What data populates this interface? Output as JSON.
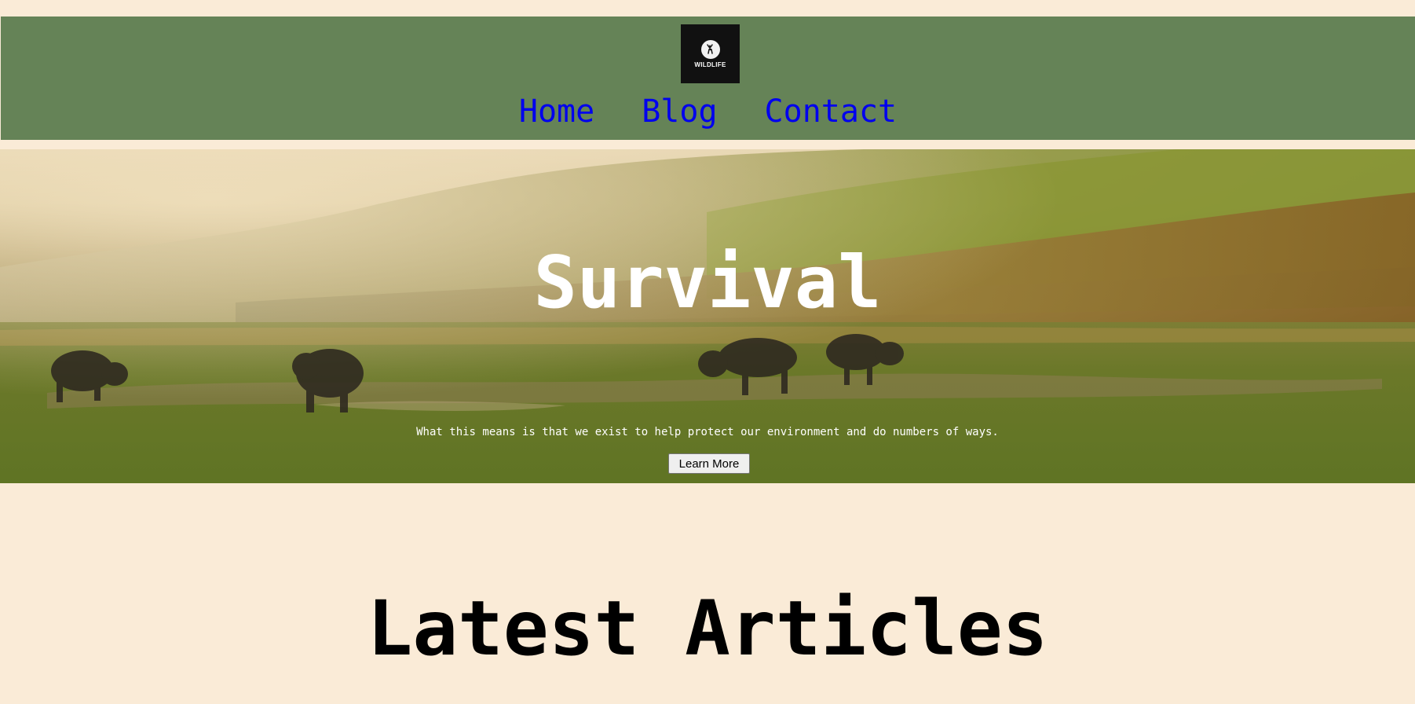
{
  "header": {
    "logo_text": "WILDLIFE",
    "nav": [
      {
        "label": "Home"
      },
      {
        "label": "Blog"
      },
      {
        "label": "Contact"
      }
    ]
  },
  "hero": {
    "title": "Survival",
    "text": "What this means is that we exist to help protect our environment and do numbers of ways.",
    "button_label": "Learn More"
  },
  "articles": {
    "title": "Latest Articles"
  },
  "colors": {
    "page_background": "#faebd7",
    "header_background": "#658357",
    "link": "#0000ee",
    "hero_text": "#ffffff"
  }
}
